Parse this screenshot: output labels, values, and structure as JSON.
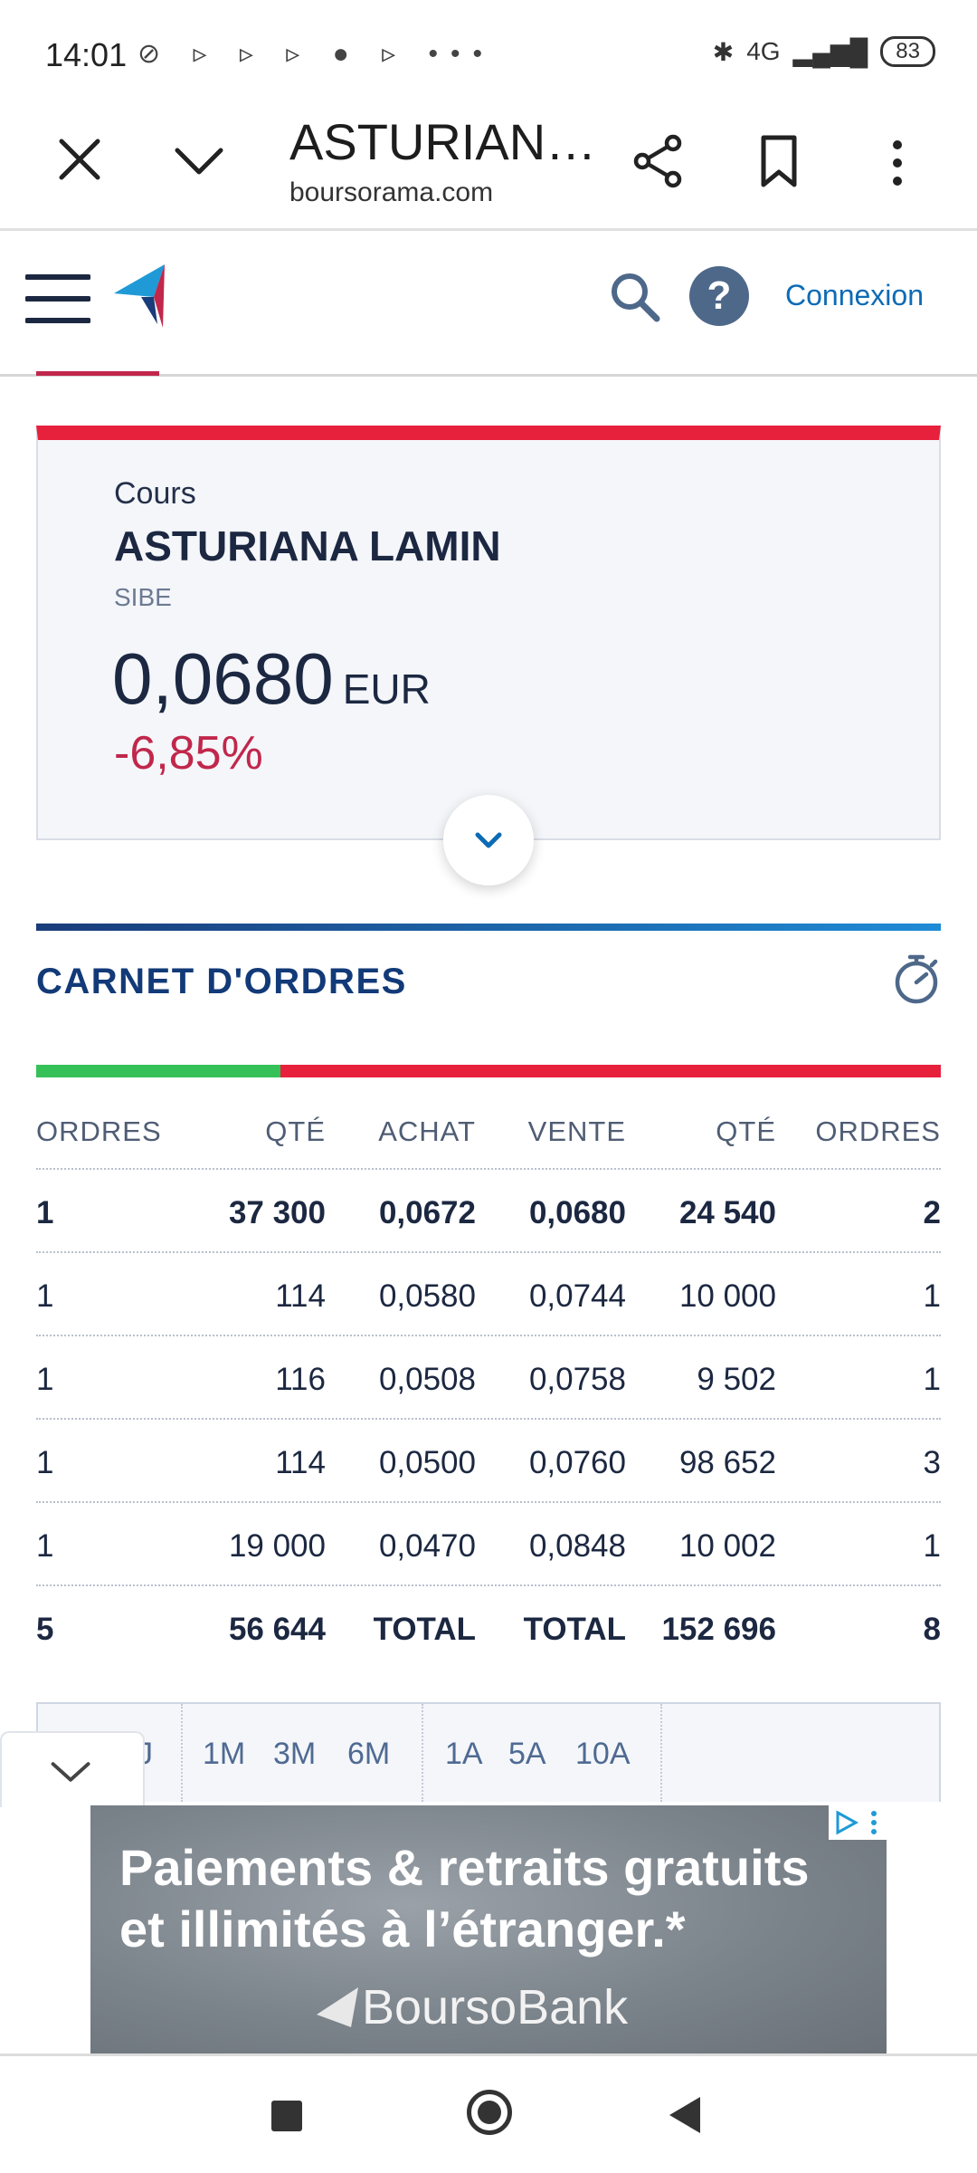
{
  "status_bar": {
    "time": "14:01",
    "left_icons": "⊘ ▹ ▹ ▹ ● ▹ •••",
    "network": "4G",
    "battery": "83"
  },
  "browser": {
    "page_title": "ASTURIAN…",
    "domain": "boursorama.com"
  },
  "site_header": {
    "help_label": "?",
    "login_label": "Connexion"
  },
  "quote": {
    "label": "Cours",
    "name": "ASTURIANA LAMIN",
    "market": "SIBE",
    "price": "0,0680",
    "currency": "EUR",
    "variation": "-6,85%",
    "variation_color": "#c1274b"
  },
  "order_book": {
    "title": "CARNET D'ORDRES",
    "buy_ratio": 0.27,
    "headers": [
      "ORDRES",
      "QTÉ",
      "ACHAT",
      "VENTE",
      "QTÉ",
      "ORDRES"
    ],
    "rows": [
      [
        "1",
        "37 300",
        "0,0672",
        "0,0680",
        "24 540",
        "2"
      ],
      [
        "1",
        "114",
        "0,0580",
        "0,0744",
        "10 000",
        "1"
      ],
      [
        "1",
        "116",
        "0,0508",
        "0,0758",
        "9 502",
        "1"
      ],
      [
        "1",
        "114",
        "0,0500",
        "0,0760",
        "98 652",
        "3"
      ],
      [
        "1",
        "19 000",
        "0,0470",
        "0,0848",
        "10 002",
        "1"
      ]
    ],
    "total_row": [
      "5",
      "56 644",
      "TOTAL",
      "TOTAL",
      "152 696",
      "8"
    ]
  },
  "period_selector": {
    "partial_label": "J",
    "group1": [
      "1M",
      "3M",
      "6M"
    ],
    "group2": [
      "1A",
      "5A",
      "10A"
    ]
  },
  "ad": {
    "line1": "Paiements & retraits gratuits",
    "line2": "et illimités à l’étranger.*",
    "brand": "BoursoBank"
  }
}
